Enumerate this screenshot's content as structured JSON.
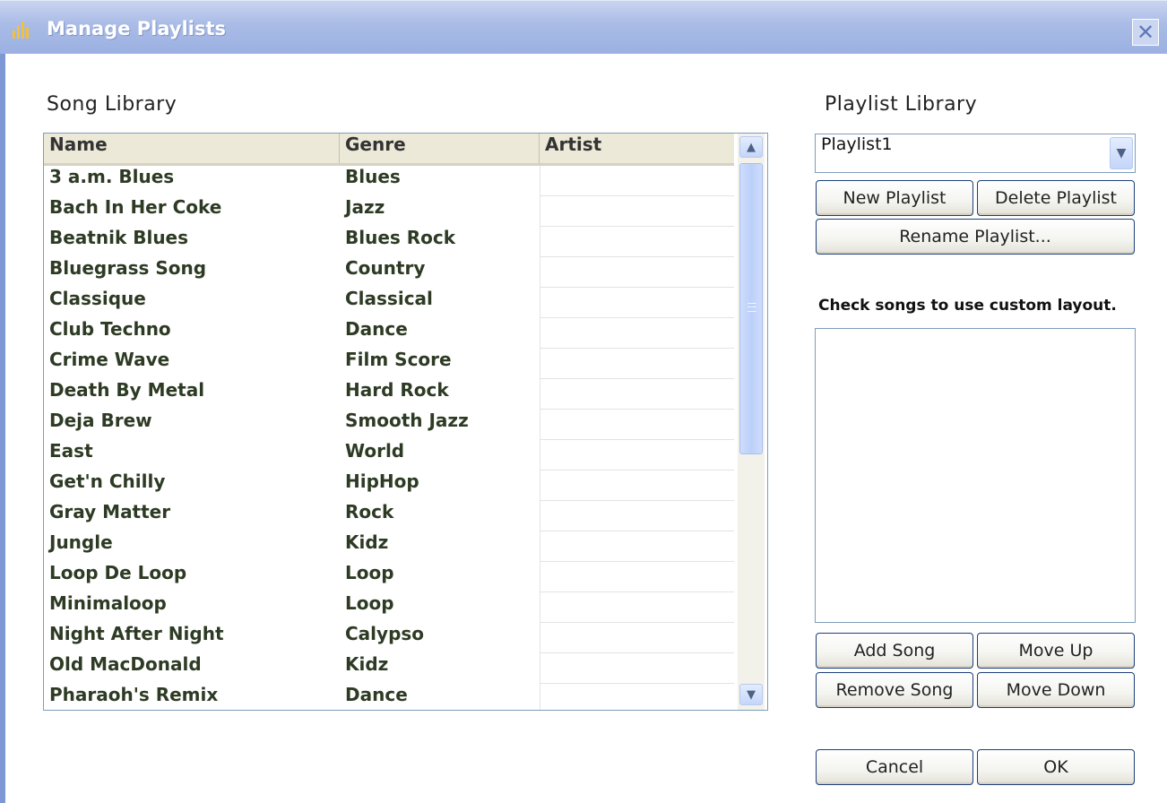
{
  "window": {
    "title": "Manage Playlists",
    "close_glyph": "✕",
    "icon": "equalizer-icon"
  },
  "song_library": {
    "title": "Song Library",
    "columns": [
      "Name",
      "Genre",
      "Artist"
    ],
    "rows": [
      {
        "name": "3 a.m. Blues",
        "genre": "Blues",
        "artist": ""
      },
      {
        "name": "Bach In Her Coke",
        "genre": "Jazz",
        "artist": ""
      },
      {
        "name": "Beatnik Blues",
        "genre": "Blues Rock",
        "artist": ""
      },
      {
        "name": "Bluegrass Song",
        "genre": "Country",
        "artist": ""
      },
      {
        "name": "Classique",
        "genre": "Classical",
        "artist": ""
      },
      {
        "name": "Club Techno",
        "genre": "Dance",
        "artist": ""
      },
      {
        "name": "Crime Wave",
        "genre": "Film Score",
        "artist": ""
      },
      {
        "name": "Death By Metal",
        "genre": "Hard Rock",
        "artist": ""
      },
      {
        "name": "Deja Brew",
        "genre": "Smooth Jazz",
        "artist": ""
      },
      {
        "name": "East",
        "genre": "World",
        "artist": ""
      },
      {
        "name": "Get'n Chilly",
        "genre": "HipHop",
        "artist": ""
      },
      {
        "name": "Gray Matter",
        "genre": "Rock",
        "artist": ""
      },
      {
        "name": "Jungle",
        "genre": "Kidz",
        "artist": ""
      },
      {
        "name": "Loop De Loop",
        "genre": "Loop",
        "artist": ""
      },
      {
        "name": "Minimaloop",
        "genre": "Loop",
        "artist": ""
      },
      {
        "name": "Night After Night",
        "genre": "Calypso",
        "artist": ""
      },
      {
        "name": "Old MacDonald",
        "genre": "Kidz",
        "artist": ""
      },
      {
        "name": "Pharaoh's Remix",
        "genre": "Dance",
        "artist": ""
      }
    ],
    "scroll_up_glyph": "▲",
    "scroll_down_glyph": "▼"
  },
  "playlist_library": {
    "title": "Playlist Library",
    "selected_playlist": "Playlist1",
    "dropdown_glyph": "▼",
    "new_playlist_label": "New Playlist",
    "delete_playlist_label": "Delete Playlist",
    "rename_playlist_label": "Rename Playlist...",
    "custom_layout_note": "Check songs to use custom layout.",
    "add_song_label": "Add Song",
    "move_up_label": "Move Up",
    "remove_song_label": "Remove Song",
    "move_down_label": "Move Down"
  },
  "footer": {
    "cancel_label": "Cancel",
    "ok_label": "OK"
  },
  "colors": {
    "titlebar": "#a9bbe6",
    "button_border": "#1b3f7a",
    "table_border": "#7f9db9",
    "row_text": "#2e3b24"
  }
}
